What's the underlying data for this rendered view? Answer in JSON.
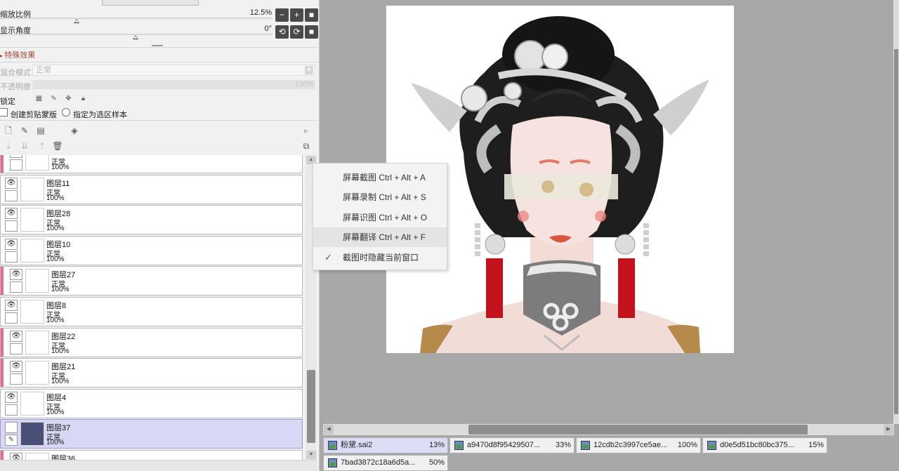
{
  "navigator": {
    "zoom_label": "缩放比例",
    "zoom_value": "12.5%",
    "angle_label": "显示角度",
    "angle_value": "0°",
    "zoom_out": "−",
    "zoom_in": "+",
    "zoom_reset": "■",
    "rotate_ccw": "⟲",
    "rotate_cw": "⟳",
    "rotate_reset": "■"
  },
  "effects": {
    "section_title": "特殊效果",
    "blend_label": "混合模式",
    "blend_value": "正常",
    "opacity_label": "不透明度",
    "opacity_value": "100%",
    "lock_label": "锁定",
    "clip_label": "创建剪贴蒙版",
    "sample_label": "指定为选区样本"
  },
  "layers": [
    {
      "name": "",
      "mode": "正常",
      "opacity": "100%",
      "pink": true,
      "visible": false,
      "selected": false,
      "partial": true
    },
    {
      "name": "图层11",
      "mode": "正常",
      "opacity": "100%",
      "pink": false,
      "visible": true,
      "selected": false
    },
    {
      "name": "图层28",
      "mode": "正常",
      "opacity": "100%",
      "pink": false,
      "visible": true,
      "selected": false
    },
    {
      "name": "图层10",
      "mode": "正常",
      "opacity": "100%",
      "pink": false,
      "visible": true,
      "selected": false
    },
    {
      "name": "图层27",
      "mode": "正常",
      "opacity": "100%",
      "pink": true,
      "visible": true,
      "selected": false
    },
    {
      "name": "图层8",
      "mode": "正常",
      "opacity": "100%",
      "pink": false,
      "visible": true,
      "selected": false
    },
    {
      "name": "图层22",
      "mode": "正常",
      "opacity": "100%",
      "pink": true,
      "visible": true,
      "selected": false
    },
    {
      "name": "图层21",
      "mode": "正常",
      "opacity": "100%",
      "pink": true,
      "visible": true,
      "selected": false
    },
    {
      "name": "图层4",
      "mode": "正常",
      "opacity": "100%",
      "pink": false,
      "visible": true,
      "selected": false
    },
    {
      "name": "图层37",
      "mode": "正常",
      "opacity": "100%",
      "pink": false,
      "visible": false,
      "selected": true
    },
    {
      "name": "图层36",
      "mode": "",
      "opacity": "",
      "pink": true,
      "visible": true,
      "selected": false
    }
  ],
  "context_menu": {
    "items": [
      {
        "label": "屏幕截图 Ctrl + Alt + A",
        "highlight": false,
        "checked": false
      },
      {
        "label": "屏幕录制 Ctrl + Alt + S",
        "highlight": false,
        "checked": false
      },
      {
        "label": "屏幕识图 Ctrl + Alt + O",
        "highlight": false,
        "checked": false
      },
      {
        "label": "屏幕翻译 Ctrl + Alt + F",
        "highlight": true,
        "checked": false
      },
      {
        "label": "截图时隐藏当前窗口",
        "highlight": false,
        "checked": true
      }
    ]
  },
  "tabs": [
    {
      "name": "粉黛.sai2",
      "zoom": "13%",
      "active": true
    },
    {
      "name": "a9470d8f95429507...",
      "zoom": "33%",
      "active": false
    },
    {
      "name": "12cdb2c3997ce5ae...",
      "zoom": "100%",
      "active": false
    },
    {
      "name": "d0e5d51bc80bc375...",
      "zoom": "15%",
      "active": false
    },
    {
      "name": "7bad3872c18a6d5a...",
      "zoom": "50%",
      "active": false
    }
  ],
  "icons": {
    "eye": "eye-icon",
    "pen": "pen-icon",
    "check": "check-icon"
  }
}
